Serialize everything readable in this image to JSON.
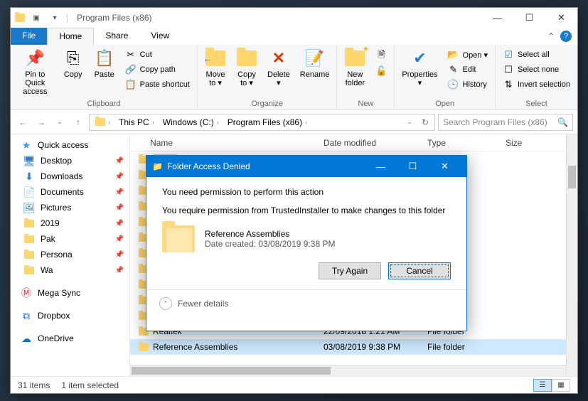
{
  "titlebar": {
    "title": "Program Files (x86)"
  },
  "tabs": {
    "file": "File",
    "home": "Home",
    "share": "Share",
    "view": "View"
  },
  "ribbon": {
    "clipboard": {
      "label": "Clipboard",
      "pin": "Pin to Quick\naccess",
      "copy": "Copy",
      "paste": "Paste",
      "cut": "Cut",
      "copypath": "Copy path",
      "pasteshortcut": "Paste shortcut"
    },
    "organize": {
      "label": "Organize",
      "moveto": "Move\nto ▾",
      "copyto": "Copy\nto ▾",
      "delete": "Delete\n▾",
      "rename": "Rename"
    },
    "new": {
      "label": "New",
      "newfolder": "New\nfolder"
    },
    "open": {
      "label": "Open",
      "properties": "Properties\n▾",
      "open": "Open ▾",
      "edit": "Edit",
      "history": "History"
    },
    "select": {
      "label": "Select",
      "all": "Select all",
      "none": "Select none",
      "invert": "Invert selection"
    }
  },
  "breadcrumb": [
    "This PC",
    "Windows (C:)",
    "Program Files (x86)"
  ],
  "search_placeholder": "Search Program Files (x86)",
  "columns": {
    "name": "Name",
    "date": "Date modified",
    "type": "Type",
    "size": "Size"
  },
  "sidebar": {
    "quick": "Quick access",
    "items": [
      {
        "label": "Desktop",
        "icon": "desktop",
        "pinned": true
      },
      {
        "label": "Downloads",
        "icon": "download",
        "pinned": true
      },
      {
        "label": "Documents",
        "icon": "document",
        "pinned": true
      },
      {
        "label": "Pictures",
        "icon": "picture",
        "pinned": true
      },
      {
        "label": "2019",
        "icon": "folder",
        "pinned": true
      },
      {
        "label": "Pak",
        "icon": "folder",
        "pinned": true
      },
      {
        "label": "Persona",
        "icon": "folder",
        "pinned": true
      },
      {
        "label": "Wa",
        "icon": "folder",
        "pinned": true
      }
    ],
    "mega": "Mega Sync",
    "dropbox": "Dropbox",
    "onedrive": "OneDrive"
  },
  "rows": [
    {
      "name": "Realtek",
      "date": "22/09/2018 1:21 AM",
      "type": "File folder",
      "selected": false
    },
    {
      "name": "Reference Assemblies",
      "date": "03/08/2019 9:38 PM",
      "type": "File folder",
      "selected": true
    }
  ],
  "status": {
    "count": "31 items",
    "selected": "1 item selected"
  },
  "dialog": {
    "title": "Folder Access Denied",
    "line1": "You need permission to perform this action",
    "line2": "You require permission from TrustedInstaller to make changes to this folder",
    "item_name": "Reference Assemblies",
    "item_date": "Date created: 03/08/2019 9:38 PM",
    "try_again": "Try Again",
    "cancel": "Cancel",
    "fewer": "Fewer details"
  }
}
